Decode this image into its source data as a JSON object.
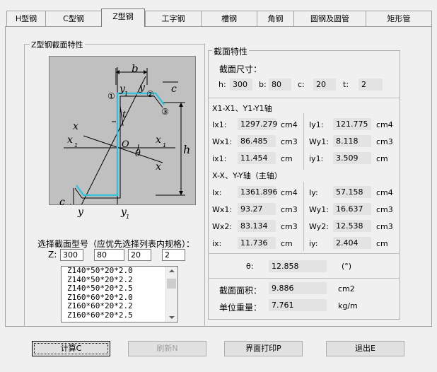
{
  "tabs": [
    "H型钢",
    "C型钢",
    "Z型钢",
    "工字钢",
    "槽钢",
    "角钢",
    "圆钢及圆管",
    "矩形管"
  ],
  "left_group_title": "Z型钢截面特性",
  "diagram": {
    "labels": {
      "b": "b",
      "c": "c",
      "t": "t",
      "h": "h",
      "o": "O",
      "theta": "θ",
      "x": "x",
      "x1": "x",
      "y": "y",
      "y1": "y",
      "sub1": "1",
      "n1": "①",
      "n2": "②",
      "n3": "③"
    }
  },
  "select_label": "选择截面型号（应优先选择列表内规格）：",
  "z_label": "Z:",
  "z_inputs": [
    "300",
    "80",
    "20",
    "2"
  ],
  "list_items": [
    "Z140*50*20*2.0",
    "Z140*50*20*2.2",
    "Z140*50*20*2.5",
    "Z160*60*20*2.0",
    "Z160*60*20*2.2",
    "Z160*60*20*2.5"
  ],
  "right_group_title": "截面特性",
  "dims_title": "截面尺寸：",
  "dims": [
    {
      "label": "h:",
      "value": "300"
    },
    {
      "label": "b:",
      "value": "80"
    },
    {
      "label": "c:",
      "value": "20"
    },
    {
      "label": "t:",
      "value": "2"
    }
  ],
  "axis1_title": "X1-X1、Y1-Y1轴",
  "axis1_rows": [
    {
      "l1": "Ix1:",
      "v1": "1297.279",
      "u1": "cm4",
      "l2": "Iy1:",
      "v2": "121.775",
      "u2": "cm4"
    },
    {
      "l1": "Wx1:",
      "v1": "86.485",
      "u1": "cm3",
      "l2": "Wy1:",
      "v2": "8.118",
      "u2": "cm3"
    },
    {
      "l1": "ix1:",
      "v1": "11.454",
      "u1": "cm",
      "l2": "iy1:",
      "v2": "3.509",
      "u2": "cm"
    }
  ],
  "axis2_title": "X-X、Y-Y轴（主轴）",
  "axis2_rows": [
    {
      "l1": "Ix:",
      "v1": "1361.896",
      "u1": "cm4",
      "l2": "Iy:",
      "v2": "57.158",
      "u2": "cm4"
    },
    {
      "l1": "Wx1:",
      "v1": "93.27",
      "u1": "cm3",
      "l2": "Wy1:",
      "v2": "16.637",
      "u2": "cm3"
    },
    {
      "l1": "Wx2:",
      "v1": "83.134",
      "u1": "cm3",
      "l2": "Wy2:",
      "v2": "12.538",
      "u2": "cm3"
    },
    {
      "l1": "ix:",
      "v1": "11.736",
      "u1": "cm",
      "l2": "iy:",
      "v2": "2.404",
      "u2": "cm"
    }
  ],
  "theta": {
    "label": "θ:",
    "value": "12.858",
    "unit": "(°)"
  },
  "area": {
    "label": "截面面积：",
    "value": "9.886",
    "unit": "cm2"
  },
  "weight": {
    "label": "单位重量：",
    "value": "7.761",
    "unit": "kg/m"
  },
  "buttons": {
    "calc": "计算C",
    "refresh": "刷新N",
    "print": "界面打印P",
    "exit": "退出E"
  }
}
